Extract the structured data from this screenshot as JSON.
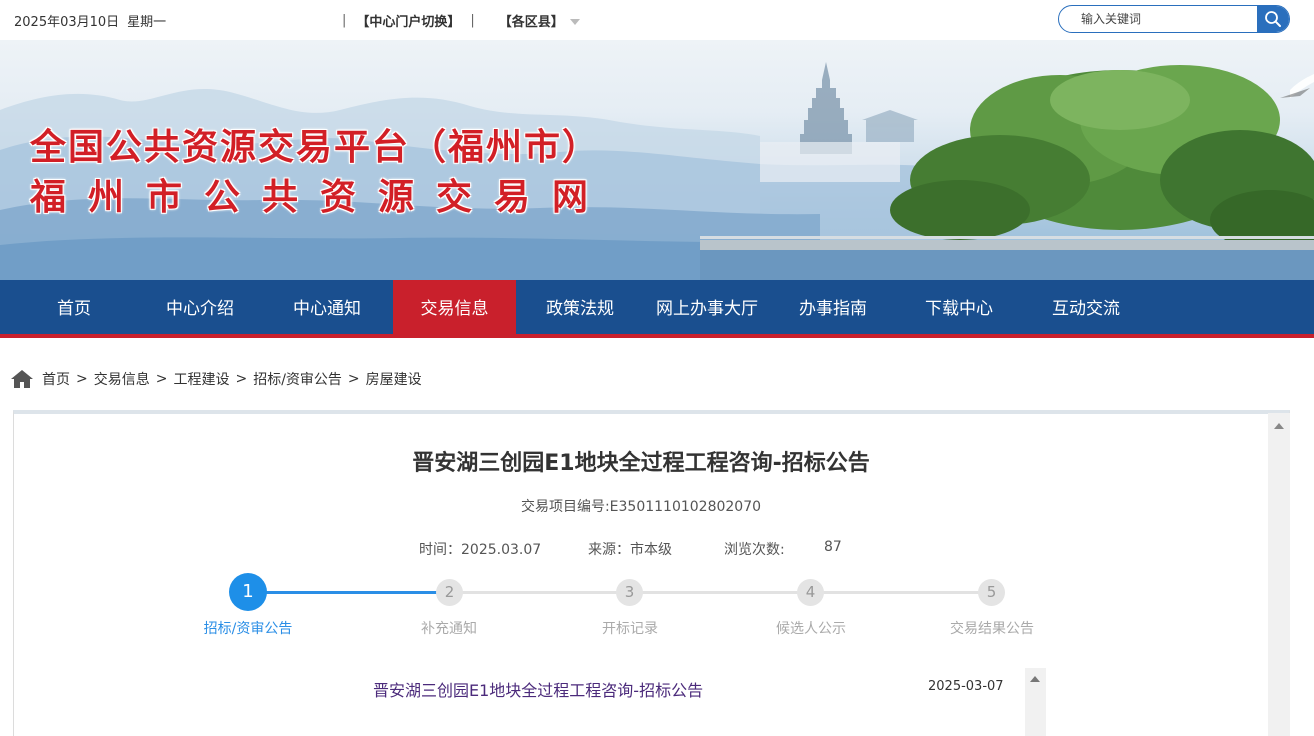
{
  "topbar": {
    "date": "2025年03月10日",
    "weekday": "星期一",
    "portal_switch": "【中心门户切换】",
    "districts": "【各区县】",
    "search_placeholder": "输入关键词"
  },
  "banner": {
    "line1": "全国公共资源交易平台（福州市）",
    "line2": "福州市公共资源交易网"
  },
  "nav": {
    "items": [
      "首页",
      "中心介绍",
      "中心通知",
      "交易信息",
      "政策法规",
      "网上办事大厅",
      "办事指南",
      "下载中心",
      "互动交流"
    ],
    "active": "交易信息"
  },
  "breadcrumb": [
    "首页",
    "交易信息",
    "工程建设",
    "招标/资审公告",
    "房屋建设"
  ],
  "article": {
    "title": "晋安湖三创园E1地块全过程工程咨询-招标公告",
    "project_no": "交易项目编号:E3501110102802070",
    "time_label": "时间：2025.03.07",
    "source_label": "来源：市本级",
    "views_label": "浏览次数:",
    "views": "87"
  },
  "steps": [
    {
      "num": "1",
      "label": "招标/资审公告"
    },
    {
      "num": "2",
      "label": "补充通知"
    },
    {
      "num": "3",
      "label": "开标记录"
    },
    {
      "num": "4",
      "label": "候选人公示"
    },
    {
      "num": "5",
      "label": "交易结果公告"
    }
  ],
  "active_step": 1,
  "list": [
    {
      "title": "晋安湖三创园E1地块全过程工程咨询-招标公告",
      "date": "2025-03-07"
    }
  ],
  "colors": {
    "nav_bg": "#1a4f8f",
    "nav_active": "#c9202c",
    "step_active": "#1e8fe8",
    "banner_title": "#d21f26"
  }
}
